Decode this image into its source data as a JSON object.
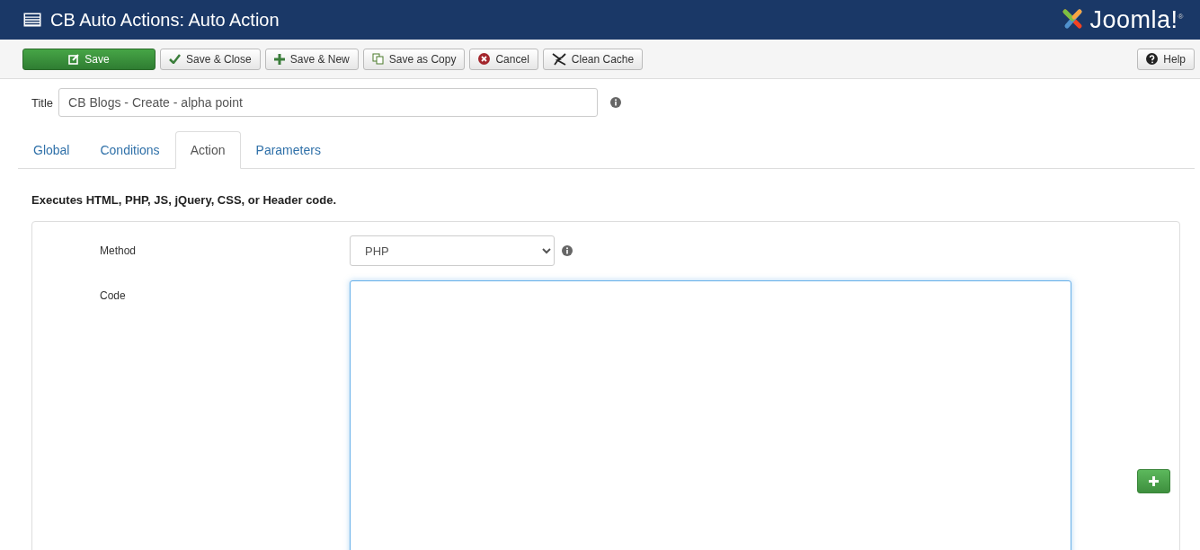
{
  "header": {
    "title": "CB Auto Actions: Auto Action",
    "logo_text": "Joomla!$^{®}$"
  },
  "toolbar": {
    "buttons": [
      {
        "kind": "save",
        "label": "Save"
      },
      {
        "kind": "check",
        "label": "Save & Close"
      },
      {
        "kind": "plus",
        "label": "Save & New"
      },
      {
        "kind": "copy",
        "label": "Save as Copy"
      },
      {
        "kind": "cancel",
        "label": "Cancel"
      },
      {
        "kind": "cache",
        "label": "Clean Cache"
      }
    ],
    "help": {
      "kind": "help",
      "label": "Help"
    }
  },
  "title_field": {
    "label": "Title",
    "value": "CB Blogs - Create - alpha point"
  },
  "tabs": [
    {
      "label": "Global",
      "selected": false
    },
    {
      "label": "Conditions",
      "selected": false
    },
    {
      "label": "Action",
      "selected": true
    },
    {
      "label": "Parameters",
      "selected": false
    }
  ],
  "description": "Executes HTML, PHP, JS, jQuery, CSS, or Header code.",
  "form": {
    "method": {
      "label": "Method",
      "value": "PHP"
    },
    "code": {
      "label": "Code"
    }
  }
}
